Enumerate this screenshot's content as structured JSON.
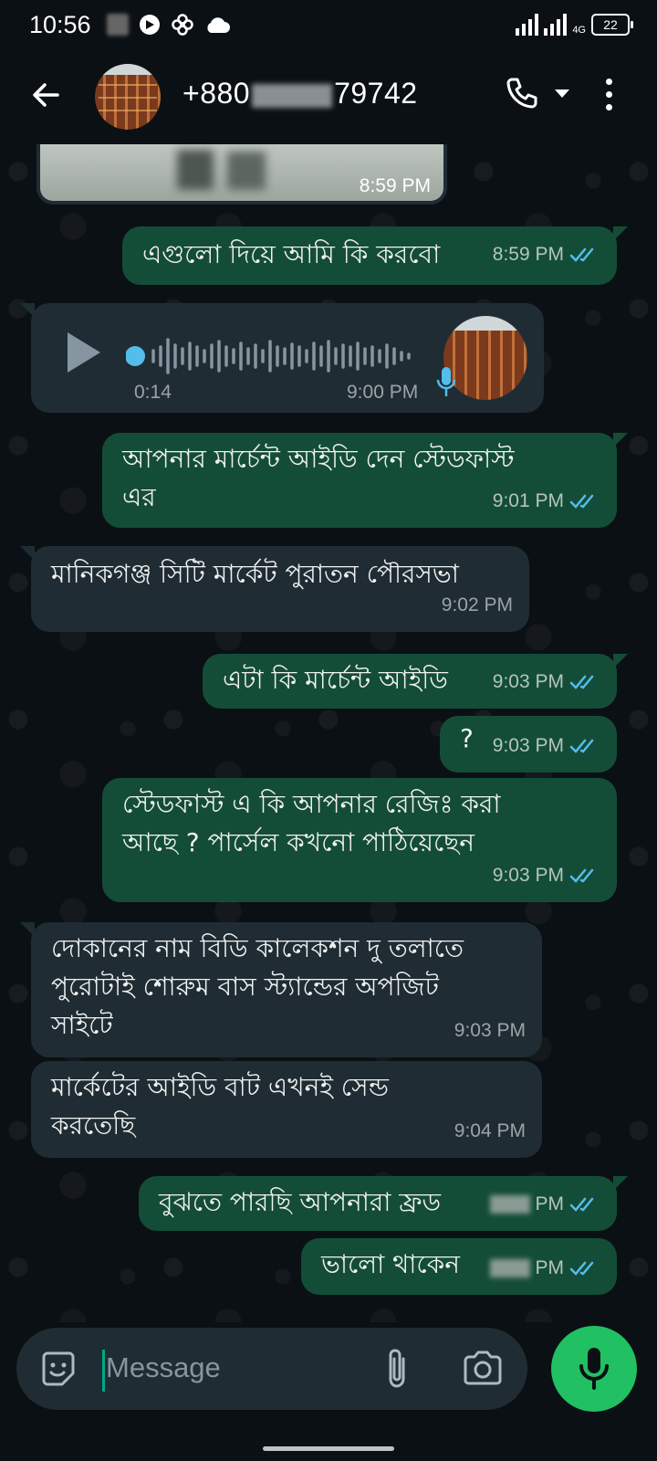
{
  "status_bar": {
    "time": "10:56",
    "network": "4G",
    "battery": "22"
  },
  "header": {
    "contact_name_prefix": "+880",
    "contact_name_suffix": "79742"
  },
  "messages": [
    {
      "type": "image",
      "direction": "in",
      "time": "8:59 PM"
    },
    {
      "type": "text",
      "direction": "out",
      "text": "এগুলো দিয়ে আমি কি করবো",
      "time": "8:59 PM",
      "status": "read"
    },
    {
      "type": "voice",
      "direction": "in",
      "duration": "0:14",
      "time": "9:00 PM"
    },
    {
      "type": "text",
      "direction": "out",
      "lines": [
        "আপনার মার্চেন্ট আইডি দেন স্টেডফাস্ট",
        "এর"
      ],
      "time": "9:01 PM",
      "status": "read"
    },
    {
      "type": "text",
      "direction": "in",
      "text": "মানিকগঞ্জ সিটি মার্কেট পুরাতন পৌরসভা",
      "time": "9:02 PM"
    },
    {
      "type": "text",
      "direction": "out",
      "text": "এটা কি মার্চেন্ট আইডি",
      "time": "9:03 PM",
      "status": "read"
    },
    {
      "type": "text",
      "direction": "out",
      "text": "?",
      "time": "9:03 PM",
      "status": "read"
    },
    {
      "type": "text",
      "direction": "out",
      "lines": [
        "স্টেডফাস্ট এ কি আপনার রেজিঃ করা",
        "আছে ? পার্সেল কখনো পাঠিয়েছেন"
      ],
      "time": "9:03 PM",
      "status": "read"
    },
    {
      "type": "text",
      "direction": "in",
      "lines": [
        "দোকানের নাম বিডি কালেকশন দু তলাতে",
        "পুরোটাই শোরুম বাস স্ট্যান্ডের অপজিট",
        "সাইটে"
      ],
      "time": "9:03 PM"
    },
    {
      "type": "text",
      "direction": "in",
      "lines": [
        "মার্কেটের আইডি বাট এখনই সেন্ড",
        "করতেছি"
      ],
      "time": "9:04 PM"
    },
    {
      "type": "text",
      "direction": "out",
      "text": "বুঝতে পারছি আপনারা ফ্রড",
      "time": "PM",
      "status": "read"
    },
    {
      "type": "text",
      "direction": "out",
      "text": "ভালো থাকেন",
      "time": "PM",
      "status": "read"
    }
  ],
  "composer": {
    "placeholder": "Message"
  },
  "colors": {
    "outgoing": "#144d37",
    "incoming": "#202c33",
    "accent": "#21c063",
    "read_tick": "#53bdeb"
  },
  "icons": [
    "back-arrow-icon",
    "call-icon",
    "chevron-down-icon",
    "more-vert-icon",
    "play-icon",
    "mic-icon",
    "emoji-icon",
    "attach-icon",
    "camera-icon"
  ]
}
